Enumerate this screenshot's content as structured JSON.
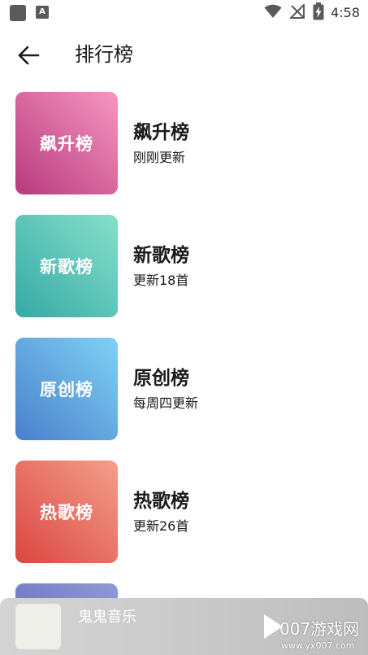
{
  "status_bar": {
    "time": "4:58",
    "notification_icon_label": "A"
  },
  "app_bar": {
    "title": "排行榜"
  },
  "charts": [
    {
      "cover_label": "飙升榜",
      "title": "飙升榜",
      "subtitle": "刚刚更新",
      "gradient": [
        "#f797c1",
        "#b7397c"
      ]
    },
    {
      "cover_label": "新歌榜",
      "title": "新歌榜",
      "subtitle": "更新18首",
      "gradient": [
        "#86e0ca",
        "#35a9a6"
      ]
    },
    {
      "cover_label": "原创榜",
      "title": "原创榜",
      "subtitle": "每周四更新",
      "gradient": [
        "#7fd2f5",
        "#4a7fcb"
      ]
    },
    {
      "cover_label": "热歌榜",
      "title": "热歌榜",
      "subtitle": "更新26首",
      "gradient": [
        "#f3a08c",
        "#db4541"
      ]
    },
    {
      "gradient": [
        "#8e9bd6",
        "#5d67b6"
      ]
    }
  ],
  "player": {
    "title": "鬼鬼音乐",
    "play_icon": "play-icon"
  },
  "watermark": {
    "text": "007游戏网",
    "url": "www.yx007.com"
  }
}
